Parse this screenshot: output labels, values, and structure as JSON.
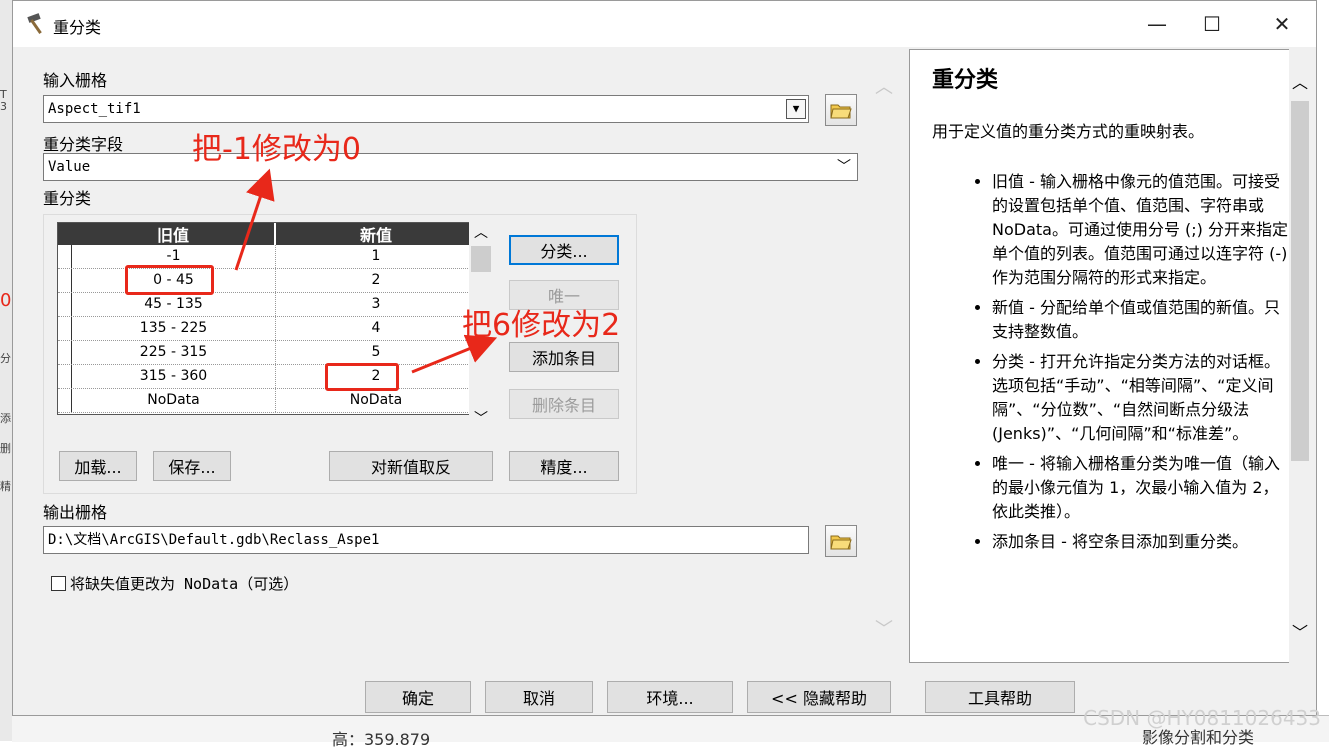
{
  "window": {
    "title": "重分类",
    "minimize": "—",
    "maximize": "☐",
    "close": "✕"
  },
  "form": {
    "input_raster_label": "输入栅格",
    "input_raster_value": "Aspect_tif1",
    "field_label": "重分类字段",
    "field_value": "Value",
    "reclass_label": "重分类",
    "table": {
      "headers": [
        "旧值",
        "新值"
      ],
      "rows": [
        {
          "old": "-1",
          "new": "1"
        },
        {
          "old": "0 - 45",
          "new": "2"
        },
        {
          "old": "45 - 135",
          "new": "3"
        },
        {
          "old": "135 - 225",
          "new": "4"
        },
        {
          "old": "225 - 315",
          "new": "5"
        },
        {
          "old": "315 - 360",
          "new": "2"
        },
        {
          "old": "NoData",
          "new": "NoData"
        }
      ]
    },
    "buttons": {
      "classify": "分类...",
      "unique": "唯一",
      "add_entry": "添加条目",
      "delete_entry": "删除条目",
      "load": "加载...",
      "save": "保存...",
      "reverse": "对新值取反",
      "precision": "精度..."
    },
    "output_raster_label": "输出栅格",
    "output_raster_value": "D:\\文档\\ArcGIS\\Default.gdb\\Reclass_Aspe1",
    "nodata_checkbox_label": "将缺失值更改为 NoData（可选）",
    "nodata_checked": false
  },
  "help": {
    "title": "重分类",
    "intro": "用于定义值的重分类方式的重映射表。",
    "items": [
      "旧值 - 输入栅格中像元的值范围。可接受的设置包括单个值、值范围、字符串或 NoData。可通过使用分号 (;) 分开来指定单个值的列表。值范围可通过以连字符 (-) 作为范围分隔符的形式来指定。",
      "新值 - 分配给单个值或值范围的新值。只支持整数值。",
      "分类 - 打开允许指定分类方法的对话框。选项包括“手动”、“相等间隔”、“定义间隔”、“分位数”、“自然间断点分级法 (Jenks)”、“几何间隔”和“标准差”。",
      "唯一 - 将输入栅格重分类为唯一值（输入的最小像元值为 1，次最小输入值为 2，依此类推）。",
      "添加条目 - 将空条目添加到重分类。"
    ]
  },
  "footer": {
    "ok": "确定",
    "cancel": "取消",
    "environments": "环境...",
    "hide_help": "<< 隐藏帮助",
    "tool_help": "工具帮助"
  },
  "annotations": {
    "note1": "把-1修改为0",
    "note2": "把6修改为2",
    "color": "#e8281a"
  },
  "background": {
    "status_text": "高：359.879",
    "tree_item": "影像分割和分类",
    "watermark": "CSDN @HY0811026433"
  }
}
